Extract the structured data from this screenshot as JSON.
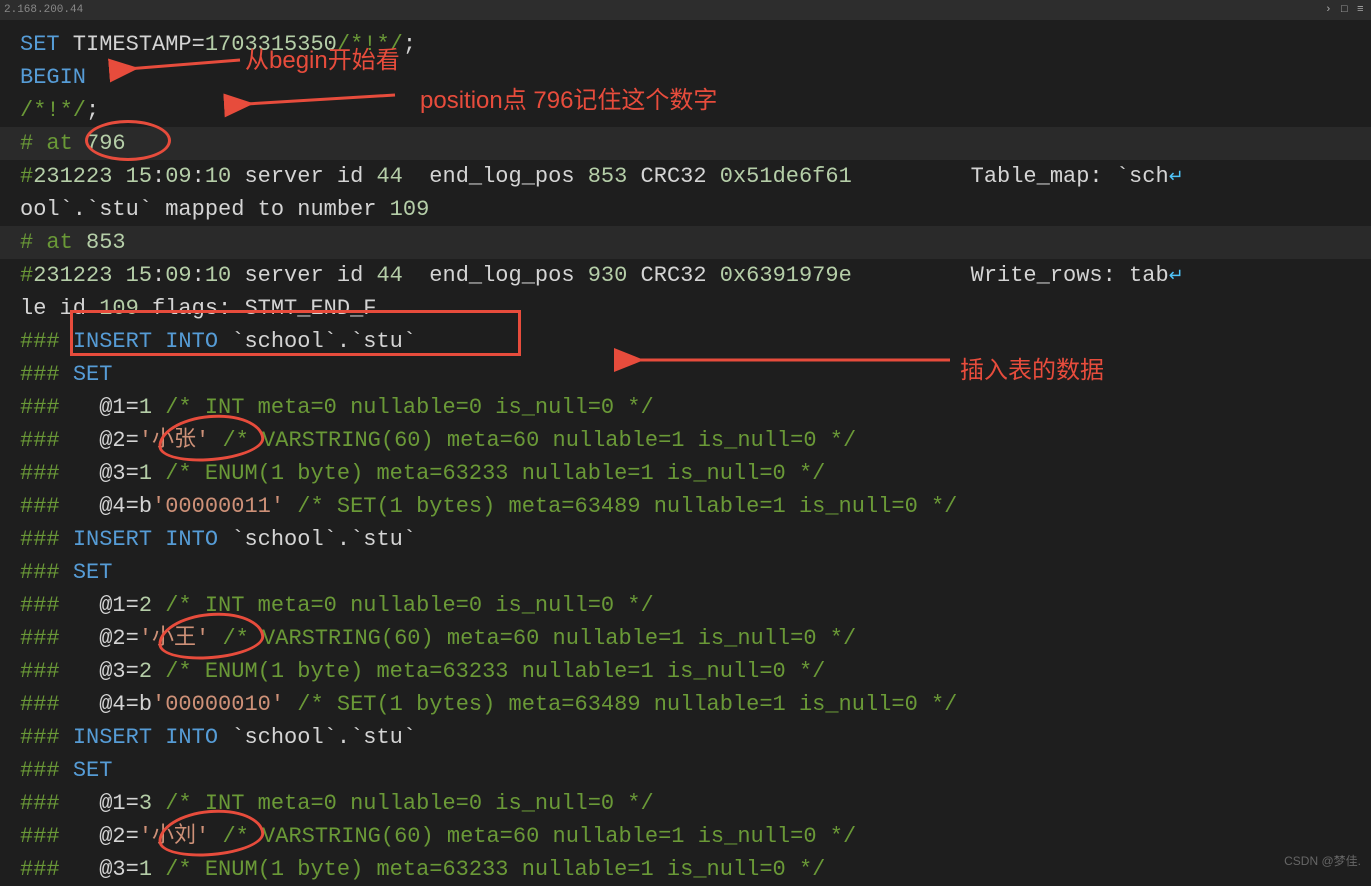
{
  "titlebar": {
    "ip": "2.168.200.44"
  },
  "lines": [
    {
      "gutter": false,
      "spans": [
        {
          "c": "blue",
          "t": "SET"
        },
        {
          "c": "default",
          "t": " TIMESTAMP"
        },
        {
          "c": "op",
          "t": "="
        },
        {
          "c": "num",
          "t": "1703315350"
        },
        {
          "c": "cmt",
          "t": "/*!*/"
        },
        {
          "c": "default",
          "t": ";"
        }
      ]
    },
    {
      "gutter": false,
      "spans": [
        {
          "c": "blue",
          "t": "BEGIN"
        }
      ]
    },
    {
      "gutter": false,
      "spans": [
        {
          "c": "cmt",
          "t": "/*!*/"
        },
        {
          "c": "default",
          "t": ";"
        }
      ]
    },
    {
      "gutter": true,
      "hl": true,
      "spans": [
        {
          "c": "hash",
          "t": "# at "
        },
        {
          "c": "num",
          "t": "796"
        }
      ]
    },
    {
      "gutter": false,
      "spans": [
        {
          "c": "hash",
          "t": "#"
        },
        {
          "c": "num",
          "t": "231223"
        },
        {
          "c": "default",
          "t": " "
        },
        {
          "c": "num",
          "t": "15"
        },
        {
          "c": "default",
          "t": ":"
        },
        {
          "c": "num",
          "t": "09"
        },
        {
          "c": "default",
          "t": ":"
        },
        {
          "c": "num",
          "t": "10"
        },
        {
          "c": "default",
          "t": " server id "
        },
        {
          "c": "num",
          "t": "44"
        },
        {
          "c": "default",
          "t": "  end_log_pos "
        },
        {
          "c": "num",
          "t": "853"
        },
        {
          "c": "default",
          "t": " CRC32 "
        },
        {
          "c": "num",
          "t": "0x51de6f61"
        },
        {
          "c": "default",
          "t": "         Table_map: `sch"
        },
        {
          "c": "wrap",
          "t": "↵"
        }
      ]
    },
    {
      "gutter": false,
      "spans": [
        {
          "c": "default",
          "t": "ool`.`stu` mapped to number "
        },
        {
          "c": "num",
          "t": "109"
        }
      ]
    },
    {
      "gutter": false,
      "hl": true,
      "spans": [
        {
          "c": "hash",
          "t": "# at "
        },
        {
          "c": "num",
          "t": "853"
        }
      ]
    },
    {
      "gutter": false,
      "spans": [
        {
          "c": "hash",
          "t": "#"
        },
        {
          "c": "num",
          "t": "231223"
        },
        {
          "c": "default",
          "t": " "
        },
        {
          "c": "num",
          "t": "15"
        },
        {
          "c": "default",
          "t": ":"
        },
        {
          "c": "num",
          "t": "09"
        },
        {
          "c": "default",
          "t": ":"
        },
        {
          "c": "num",
          "t": "10"
        },
        {
          "c": "default",
          "t": " server id "
        },
        {
          "c": "num",
          "t": "44"
        },
        {
          "c": "default",
          "t": "  end_log_pos "
        },
        {
          "c": "num",
          "t": "930"
        },
        {
          "c": "default",
          "t": " CRC32 "
        },
        {
          "c": "num",
          "t": "0x6391979e"
        },
        {
          "c": "default",
          "t": "         Write_rows: tab"
        },
        {
          "c": "wrap",
          "t": "↵"
        }
      ]
    },
    {
      "gutter": false,
      "spans": [
        {
          "c": "default",
          "t": "le id "
        },
        {
          "c": "num",
          "t": "109"
        },
        {
          "c": "default",
          "t": " flags: STMT_END_F"
        }
      ]
    },
    {
      "gutter": false,
      "spans": [
        {
          "c": "hash",
          "t": "### "
        },
        {
          "c": "blue",
          "t": "INSERT INTO"
        },
        {
          "c": "default",
          "t": " `school`.`stu`"
        }
      ]
    },
    {
      "gutter": false,
      "spans": [
        {
          "c": "hash",
          "t": "### "
        },
        {
          "c": "blue",
          "t": "SET"
        }
      ]
    },
    {
      "gutter": false,
      "spans": [
        {
          "c": "hash",
          "t": "###   "
        },
        {
          "c": "default",
          "t": "@1="
        },
        {
          "c": "num",
          "t": "1"
        },
        {
          "c": "default",
          "t": " "
        },
        {
          "c": "cmt",
          "t": "/* INT meta=0 nullable=0 is_null=0 */"
        }
      ]
    },
    {
      "gutter": false,
      "spans": [
        {
          "c": "hash",
          "t": "###   "
        },
        {
          "c": "default",
          "t": "@2="
        },
        {
          "c": "str",
          "t": "'小张'"
        },
        {
          "c": "default",
          "t": " "
        },
        {
          "c": "cmt",
          "t": "/* VARSTRING(60) meta=60 nullable=1 is_null=0 */"
        }
      ]
    },
    {
      "gutter": false,
      "spans": [
        {
          "c": "hash",
          "t": "###   "
        },
        {
          "c": "default",
          "t": "@3="
        },
        {
          "c": "num",
          "t": "1"
        },
        {
          "c": "default",
          "t": " "
        },
        {
          "c": "cmt",
          "t": "/* ENUM(1 byte) meta=63233 nullable=1 is_null=0 */"
        }
      ]
    },
    {
      "gutter": false,
      "spans": [
        {
          "c": "hash",
          "t": "###   "
        },
        {
          "c": "default",
          "t": "@4=b"
        },
        {
          "c": "str",
          "t": "'00000011'"
        },
        {
          "c": "default",
          "t": " "
        },
        {
          "c": "cmt",
          "t": "/* SET(1 bytes) meta=63489 nullable=1 is_null=0 */"
        }
      ]
    },
    {
      "gutter": false,
      "spans": [
        {
          "c": "hash",
          "t": "### "
        },
        {
          "c": "blue",
          "t": "INSERT INTO"
        },
        {
          "c": "default",
          "t": " `school`.`stu`"
        }
      ]
    },
    {
      "gutter": false,
      "spans": [
        {
          "c": "hash",
          "t": "### "
        },
        {
          "c": "blue",
          "t": "SET"
        }
      ]
    },
    {
      "gutter": false,
      "spans": [
        {
          "c": "hash",
          "t": "###   "
        },
        {
          "c": "default",
          "t": "@1="
        },
        {
          "c": "num",
          "t": "2"
        },
        {
          "c": "default",
          "t": " "
        },
        {
          "c": "cmt",
          "t": "/* INT meta=0 nullable=0 is_null=0 */"
        }
      ]
    },
    {
      "gutter": false,
      "spans": [
        {
          "c": "hash",
          "t": "###   "
        },
        {
          "c": "default",
          "t": "@2="
        },
        {
          "c": "str",
          "t": "'小王'"
        },
        {
          "c": "default",
          "t": " "
        },
        {
          "c": "cmt",
          "t": "/* VARSTRING(60) meta=60 nullable=1 is_null=0 */"
        }
      ]
    },
    {
      "gutter": false,
      "spans": [
        {
          "c": "hash",
          "t": "###   "
        },
        {
          "c": "default",
          "t": "@3="
        },
        {
          "c": "num",
          "t": "2"
        },
        {
          "c": "default",
          "t": " "
        },
        {
          "c": "cmt",
          "t": "/* ENUM(1 byte) meta=63233 nullable=1 is_null=0 */"
        }
      ]
    },
    {
      "gutter": false,
      "spans": [
        {
          "c": "hash",
          "t": "###   "
        },
        {
          "c": "default",
          "t": "@4=b"
        },
        {
          "c": "str",
          "t": "'00000010'"
        },
        {
          "c": "default",
          "t": " "
        },
        {
          "c": "cmt",
          "t": "/* SET(1 bytes) meta=63489 nullable=1 is_null=0 */"
        }
      ]
    },
    {
      "gutter": false,
      "spans": [
        {
          "c": "hash",
          "t": "### "
        },
        {
          "c": "blue",
          "t": "INSERT INTO"
        },
        {
          "c": "default",
          "t": " `school`.`stu`"
        }
      ]
    },
    {
      "gutter": false,
      "spans": [
        {
          "c": "hash",
          "t": "### "
        },
        {
          "c": "blue",
          "t": "SET"
        }
      ]
    },
    {
      "gutter": false,
      "spans": [
        {
          "c": "hash",
          "t": "###   "
        },
        {
          "c": "default",
          "t": "@1="
        },
        {
          "c": "num",
          "t": "3"
        },
        {
          "c": "default",
          "t": " "
        },
        {
          "c": "cmt",
          "t": "/* INT meta=0 nullable=0 is_null=0 */"
        }
      ]
    },
    {
      "gutter": false,
      "spans": [
        {
          "c": "hash",
          "t": "###   "
        },
        {
          "c": "default",
          "t": "@2="
        },
        {
          "c": "str",
          "t": "'小刘'"
        },
        {
          "c": "default",
          "t": " "
        },
        {
          "c": "cmt",
          "t": "/* VARSTRING(60) meta=60 nullable=1 is_null=0 */"
        }
      ]
    },
    {
      "gutter": false,
      "spans": [
        {
          "c": "hash",
          "t": "###   "
        },
        {
          "c": "default",
          "t": "@3="
        },
        {
          "c": "num",
          "t": "1"
        },
        {
          "c": "default",
          "t": " "
        },
        {
          "c": "cmt",
          "t": "/* ENUM(1 byte) meta=63233 nullable=1 is_null=0 */"
        }
      ]
    }
  ],
  "annotations": {
    "begin_label": "从begin开始看",
    "position_label": "position点 796记住这个数字",
    "insert_label": "插入表的数据"
  },
  "watermark": "CSDN @梦佳."
}
